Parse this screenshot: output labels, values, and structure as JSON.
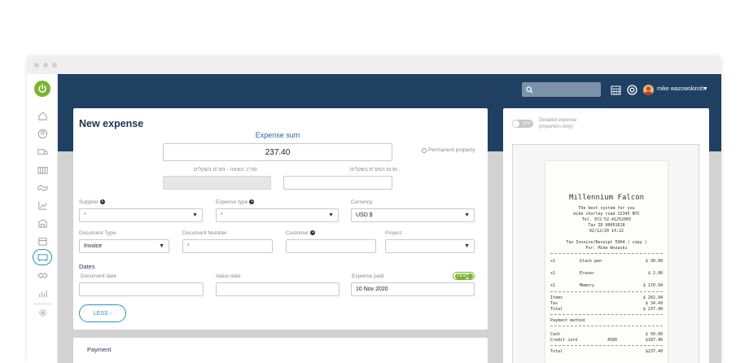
{
  "topbar": {
    "search_placeholder": "",
    "user_name": "mike wazowskinsh"
  },
  "form": {
    "title": "New expense",
    "expense_sum_label": "Expense sum",
    "expense_sum_value": "237.40",
    "permanent_property": "Permanent property",
    "total_sum_label_hebrew": "סה\"כ הוצאה - מע\"מ בשקלים",
    "vat_sum_label_hebrew": "סכום המע\"מ בשקלים",
    "supplier_label": "Supplier",
    "expense_type_label": "Expense type",
    "currency_label": "Currency",
    "currency_value": "USD $",
    "required_mark": "*",
    "document_type_label": "Document Type",
    "document_type_value": "Invoice",
    "document_number_label": "Document Number",
    "customer_label": "Customer",
    "project_label": "Project",
    "dates_title": "Dates",
    "document_date_label": "Document date",
    "value_date_label": "Value date",
    "expense_paid_label": "Expense paid",
    "expense_paid_toggle": "YES",
    "expense_paid_value": "10 Nov 2020",
    "less_button": "LESS -"
  },
  "payment": {
    "title": "Payment"
  },
  "right_panel": {
    "toggle_label": "OFF",
    "detailed_expense": "Detailed expense",
    "importers_only": "(importers only)"
  },
  "receipt": {
    "store": "Millennium Falcon",
    "tagline": "The best system for you",
    "address": "mike chorley road 12345 NYC",
    "tel": "Tel. 972-52-41252065",
    "tax_id": "Tax ID 00091618",
    "datetime": "02/12/20 14:22",
    "invoice_line": "Tax Invoice/Receipt 5904 ( copy )",
    "for_line": "For: Mike Wozaski",
    "items": [
      {
        "qty": "x1",
        "name": "black pen",
        "price": "$ 30.00"
      },
      {
        "qty": "x1",
        "name": "Eraser",
        "price": "$ 2.00"
      },
      {
        "qty": "x1",
        "name": "Memory",
        "price": "$ 170.94"
      }
    ],
    "items_label": "Items",
    "items_value": "$ 202.94",
    "tax_label": "Tax",
    "tax_value": "$ 34.49",
    "total_label": "Total",
    "total_value": "$ 237.40",
    "payment_method": "Payment method",
    "cash_label": "Cash",
    "cash_value": "$ 50.00",
    "credit_label": "Credit card",
    "credit_mid": "4580",
    "credit_value": "$187.40",
    "final_total_label": "Total",
    "final_total_value": "$237.40"
  },
  "colors": {
    "topbar": "#1f4063",
    "accent": "#2c8fc7",
    "green": "#7ab52f"
  }
}
